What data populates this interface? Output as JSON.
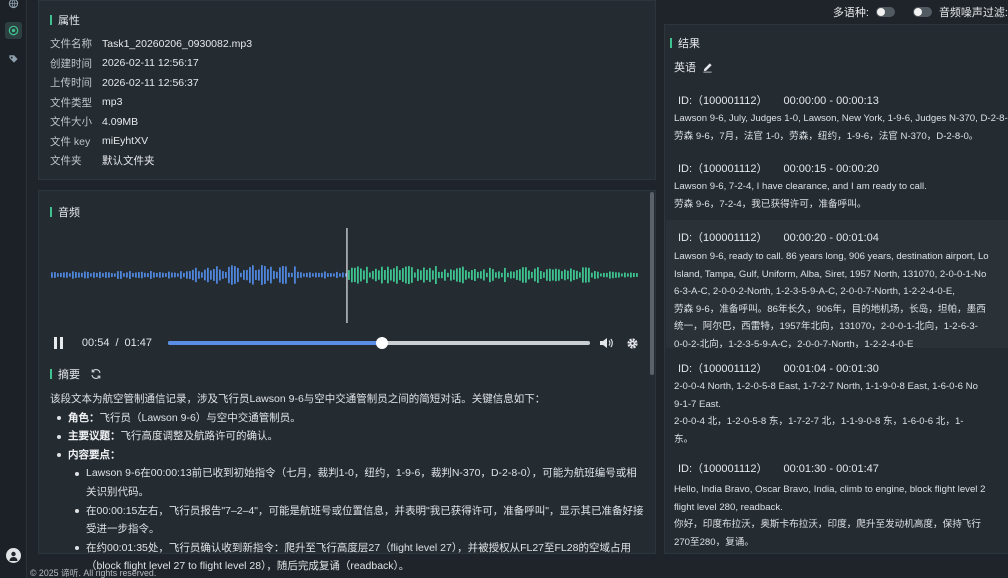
{
  "properties": {
    "title": "属性",
    "rows": [
      {
        "key": "文件名称",
        "value": "Task1_20260206_0930082.mp3"
      },
      {
        "key": "创建时间",
        "value": "2026-02-11 12:56:17"
      },
      {
        "key": "上传时间",
        "value": "2026-02-11 12:56:37"
      },
      {
        "key": "文件类型",
        "value": "mp3"
      },
      {
        "key": "文件大小",
        "value": "4.09MB"
      },
      {
        "key": "文件 key",
        "value": "miEyhtXV"
      },
      {
        "key": "文件夹",
        "value": "默认文件夹"
      }
    ]
  },
  "audio": {
    "title": "音频",
    "current_time": "00:54",
    "separator": "/",
    "total_time": "01:47",
    "progress_fraction": 0.505,
    "played_color": "#3ec28f",
    "unplayed_color": "#4f86dc"
  },
  "summary": {
    "title": "摘要",
    "intro": "该段文本为航空管制通信记录，涉及飞行员Lawson 9-6与空中交通管制员之间的简短对话。关键信息如下：",
    "role_label": "角色：",
    "role_text": "飞行员（Lawson 9-6）与空中交通管制员。",
    "topic_label": "主要议题：",
    "topic_text": "飞行高度调整及航路许可的确认。",
    "points_label": "内容要点：",
    "points": [
      "Lawson 9-6在00:00:13前已收到初始指令（七月，裁判1-0，纽约，1-9-6，裁判N-370，D-2-8-0），可能为航班编号或相关识别代码。",
      "在00:00:15左右，飞行员报告\"7–2–4\"，可能是航班号或位置信息，并表明\"我已获得许可，准备呼叫\"，显示其已准备好接受进一步指令。",
      "在约00:01:35处，飞行员确认收到新指令：爬升至飞行高度层27（flight level 27），并被授权从FL27至FL28的空域占用（block flight level 27 to flight level 28），随后完成复诵（readback）。"
    ]
  },
  "topbar": {
    "multilang_label": "多语种:",
    "noise_label": "音频噪声过滤:"
  },
  "results": {
    "title": "结果",
    "language": "英语",
    "segments": [
      {
        "id": "ID:（100001112）",
        "range": "00:00:00 - 00:00:13",
        "lines": [
          "Lawson 9-6, July, Judges 1-0, Lawson, New York, 1-9-6, Judges N-370, D-2-8-0.",
          "劳森 9-6，7月，法官 1-0，劳森，纽约，1-9-6，法官 N-370，D-2-8-0。"
        ]
      },
      {
        "id": "ID:（100001112）",
        "range": "00:00:15 - 00:00:20",
        "lines": [
          "Lawson 9-6, 7-2-4, I have clearance, and I am ready to call.",
          "劳森 9-6，7-2-4，我已获得许可，准备呼叫。"
        ]
      },
      {
        "id": "ID:（100001112）",
        "range": "00:00:20 - 00:01:04",
        "lines": [
          "Lawson 9-6, ready to call. 86 years long, 906 years, destination airport, Lo",
          "Island, Tampa, Gulf, Uniform, Alba, Siret, 1957 North, 131070, 2-0-0-1-No",
          "6-3-A-C, 2-0-0-2-North, 1-2-3-5-9-A-C, 2-0-0-7-North, 1-2-2-4-0-E,",
          "劳森 9-6，准备呼叫。86年长久，906年，目的地机场，长岛，坦帕，墨西",
          "统一，阿尔巴，西雷特，1957年北向，131070，2-0-0-1-北向，1-2-6-3-",
          "0-0-2-北向，1-2-3-5-9-A-C，2-0-0-7-North，1-2-2-4-0-E"
        ]
      },
      {
        "id": "ID:（100001112）",
        "range": "00:01:04 - 00:01:30",
        "lines": [
          "2-0-0-4 North, 1-2-0-5-8 East, 1-7-2-7 North, 1-1-9-0-8 East, 1-6-0-6 No",
          "9-1-7 East.",
          "2-0-0-4 北，1-2-0-5-8 东，1-7-2-7 北，1-1-9-0-8 东，1-6-0-6 北，1-",
          "东。"
        ]
      },
      {
        "id": "ID:（100001112）",
        "range": "00:01:30 - 00:01:47",
        "lines": [
          "Hello, India Bravo, Oscar Bravo, India, climb to engine, block flight level 2",
          "flight level 280, readback.",
          "你好，印度布拉沃，奥斯卡布拉沃，印度，爬升至发动机高度，保持飞行",
          "270至280，复诵。"
        ]
      }
    ]
  },
  "footer": {
    "copyright": "© 2025 谛听. All rights reserved."
  }
}
